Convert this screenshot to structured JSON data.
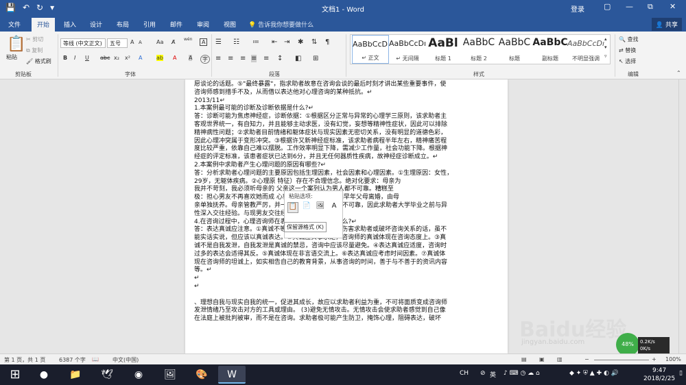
{
  "titlebar": {
    "title": "文档1 - Word",
    "login": "登录",
    "restore": "⧉",
    "min": "—",
    "close": "✕",
    "max": "▢"
  },
  "tabs": [
    "文件",
    "开始",
    "插入",
    "设计",
    "布局",
    "引用",
    "邮件",
    "审阅",
    "视图"
  ],
  "tellme": "告诉我你想要做什么",
  "share": "共享",
  "clipboard": {
    "paste": "粘贴",
    "cut": "剪切",
    "copy": "复制",
    "format_painter": "格式刷",
    "label": "剪贴板"
  },
  "font": {
    "name": "等线 (中文正文)",
    "size": "五号",
    "label": "字体",
    "wen": "wén",
    "A_big": "A",
    "A_small": "A",
    "Aa": "Aa",
    "bold": "B",
    "italic": "I",
    "underline": "U",
    "strike": "abc",
    "sub": "x₂",
    "sup": "x²"
  },
  "paragraph": {
    "label": "段落"
  },
  "styles": {
    "label": "样式",
    "items": [
      {
        "preview": "AaBbCcDı",
        "name": "↵ 正文"
      },
      {
        "preview": "AaBbCcDı",
        "name": "↵ 无间隔"
      },
      {
        "preview": "AaBl",
        "name": "标题 1"
      },
      {
        "preview": "AaBbC",
        "name": "标题 2"
      },
      {
        "preview": "AaBbC",
        "name": "标题"
      },
      {
        "preview": "AaBbC",
        "name": "副标题"
      },
      {
        "preview": "AaBbCcDı",
        "name": "不明显强调"
      }
    ]
  },
  "editing": {
    "find": "查找",
    "replace": "替换",
    "select": "选择",
    "label": "编辑"
  },
  "document": {
    "lines": [
      "愿谈论的话题。⑤\"最终暴露\"，指求助者故意在咨询会谈的最后时刻才讲出某些重要事件，使",
      "咨询师感到措手不及，从而借以表达他对心理咨询的某种抵抗。↵",
      "2013/11↵",
      "1.本案例最可能的诊断及诊断依据是什么?↵",
      "答：诊断可能为焦虑神经症，诊断依据：①根据区分正常与异常的心理学三原则，该求助者主",
      "客观世界统一，有自知力，并且能够主动求医，没有幻觉，妄想等精神性症状，因此可以排除",
      "精神病性问题；②求助者目前情绪和躯体症状与现实因素无密切关系，没有明显的道德色彩，",
      "因此心理冲突属于变形冲突。③根据许又新神经症标准，该求助者病程半年左右，精神痛苦程",
      "度比较严重，依靠自己难以摆脱。工作效率明显下降，需减少工作量，社会功能下降。根据神",
      "经症的评定标准，该患者症状已达到6分，并且无任何器质性疾病，故神经症诊断成立。↵",
      "2.本案例中求助者产生心理问题的原因有哪些?↵",
      "答：分析求助者心理问题的主要原因包括生理因素，社会因素和心理因素。①生理原因：女性，",
      "29岁，无躯体疾病。②心理原          特征）存在不合理信念。绝对化要求：母亲为",
      "我并不苛刻，我必须听母亲的          父亲这一个案列认为男人都不可靠。糟糕至",
      "极：担心男友不再喜欢她而成          心就被抛弃。③社会原因早年父母离婚，由母",
      "亲单独抚养。母亲管教严厉，并一再告诉求助者男人都不可靠，因此求助者大学毕业之前与异",
      "性深入交往经验。与现男友交往经验。↵",
      "4.在咨询过程中，心理咨询师在表达真诚时需要注意什么?↵",
      "答：表达真诚应注意。①真诚不等于说实话：那些可能伤害求助者或破坏咨询关系的话，虽不",
      "能实话实说，但应该以真诚表达。②真诚应实事求是，咨询师的真诚体现在咨询态度上。③真",
      "诚不是自我发泄，自我发泄是真诚的禁忌，咨询中应该尽量避免。④表达真诚应适度，咨询时",
      "过多的表达会适得其反。⑤真诚体现在非言语交流上。⑥表达真诚应考虑时间因素。⑦真诚体",
      "现在咨询师的坦诚上，如实相告自己的教育背景，从事咨询的时间，善于与不善于的资讯内容",
      "等。↵",
      "↵",
      "↵",
      "",
      "、理想自我与现实自我的统一，促进其成长，故应以求助者利益为重，不可将面质变成咨询师",
      "发泄情绪乃至攻击对方的工具或理由。    (3)避免无情攻击。无情攻击会使求助者感觉到自己像",
      "在法庭上被批判被审，而不是在咨询。求助者极可能产生防卫，掩饰心理，阻碍表达，破坏"
    ]
  },
  "paste_popup": {
    "title": "粘贴选项:",
    "tooltip": "保留源格式 (K)"
  },
  "statusbar": {
    "page": "第 1 页，共 1 页",
    "words": "6387 个字",
    "lang": "中文(中国)",
    "zoom": "100%"
  },
  "watermark": {
    "main": "Baidu经验",
    "sub": "jingyan.baidu.com"
  },
  "net": {
    "percent": "48%",
    "up": "0.2K/s",
    "down": "0K/s"
  },
  "tray": {
    "ime_ch": "CH",
    "ime": "英"
  },
  "clock": {
    "time": "9:47",
    "date": "2018/2/25"
  }
}
